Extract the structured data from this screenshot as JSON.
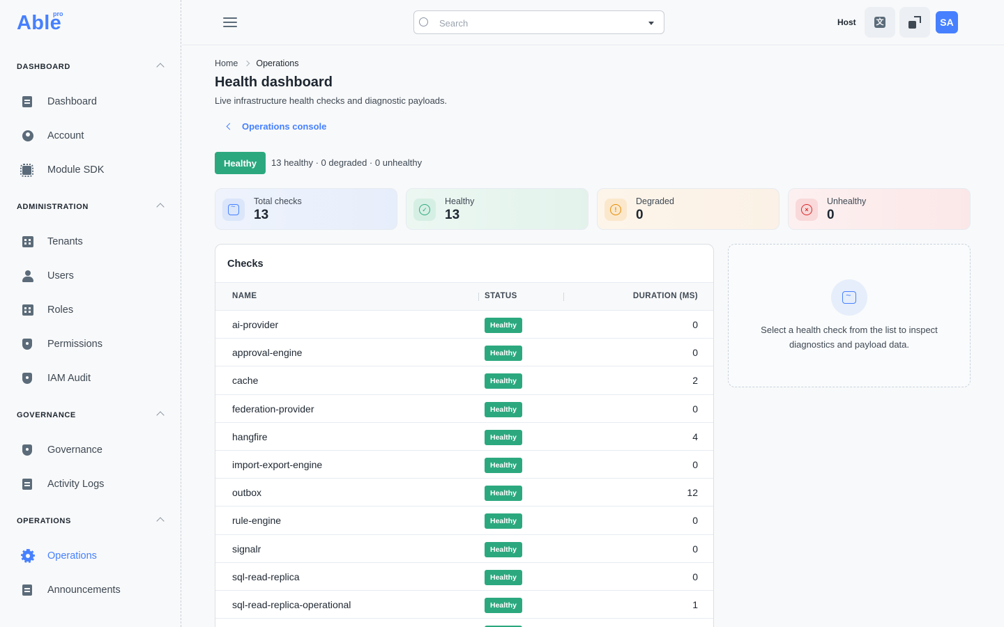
{
  "brand": {
    "name": "Able",
    "badge": "pro"
  },
  "sidebar": {
    "sections": [
      {
        "label": "DASHBOARD",
        "items": [
          {
            "label": "Dashboard",
            "icon": "document-icon"
          },
          {
            "label": "Account",
            "icon": "user-circle-icon"
          },
          {
            "label": "Module SDK",
            "icon": "chip-icon"
          }
        ]
      },
      {
        "label": "ADMINISTRATION",
        "items": [
          {
            "label": "Tenants",
            "icon": "building-icon"
          },
          {
            "label": "Users",
            "icon": "user-icon"
          },
          {
            "label": "Roles",
            "icon": "id-badge-icon"
          },
          {
            "label": "Permissions",
            "icon": "shield-icon"
          },
          {
            "label": "IAM Audit",
            "icon": "shield-icon"
          }
        ]
      },
      {
        "label": "GOVERNANCE",
        "items": [
          {
            "label": "Governance",
            "icon": "shield-icon"
          },
          {
            "label": "Activity Logs",
            "icon": "document-icon"
          }
        ]
      },
      {
        "label": "OPERATIONS",
        "items": [
          {
            "label": "Operations",
            "icon": "gear-icon",
            "active": true
          },
          {
            "label": "Announcements",
            "icon": "document-icon"
          }
        ]
      }
    ]
  },
  "header": {
    "search_placeholder": "Search",
    "host_label": "Host",
    "translate_glyph": "文",
    "avatar_initials": "SA"
  },
  "breadcrumb": {
    "home": "Home",
    "current": "Operations"
  },
  "page": {
    "title": "Health dashboard",
    "subtitle": "Live infrastructure health checks and diagnostic payloads.",
    "back_link": "Operations console",
    "overall_status": "Healthy",
    "summary": "13 healthy · 0 degraded · 0 unhealthy"
  },
  "stats": [
    {
      "label": "Total checks",
      "value": "13",
      "accent": "#4680ff"
    },
    {
      "label": "Healthy",
      "value": "13",
      "accent": "#2ca87f"
    },
    {
      "label": "Degraded",
      "value": "0",
      "accent": "#e58a00"
    },
    {
      "label": "Unhealthy",
      "value": "0",
      "accent": "#dc2626"
    }
  ],
  "checks": {
    "title": "Checks",
    "columns": {
      "name": "NAME",
      "status": "STATUS",
      "duration": "DURATION (MS)"
    },
    "rows": [
      {
        "name": "ai-provider",
        "status": "Healthy",
        "duration": "0"
      },
      {
        "name": "approval-engine",
        "status": "Healthy",
        "duration": "0"
      },
      {
        "name": "cache",
        "status": "Healthy",
        "duration": "2"
      },
      {
        "name": "federation-provider",
        "status": "Healthy",
        "duration": "0"
      },
      {
        "name": "hangfire",
        "status": "Healthy",
        "duration": "4"
      },
      {
        "name": "import-export-engine",
        "status": "Healthy",
        "duration": "0"
      },
      {
        "name": "outbox",
        "status": "Healthy",
        "duration": "12"
      },
      {
        "name": "rule-engine",
        "status": "Healthy",
        "duration": "0"
      },
      {
        "name": "signalr",
        "status": "Healthy",
        "duration": "0"
      },
      {
        "name": "sql-read-replica",
        "status": "Healthy",
        "duration": "0"
      },
      {
        "name": "sql-read-replica-operational",
        "status": "Healthy",
        "duration": "1"
      },
      {
        "name": "",
        "status": "Healthy",
        "duration": ""
      }
    ]
  },
  "detail": {
    "empty_text": "Select a health check from the list to inspect diagnostics and payload data."
  },
  "colors": {
    "accent": "#4680ff",
    "success": "#2ca87f",
    "warning": "#e58a00",
    "danger": "#dc2626"
  }
}
